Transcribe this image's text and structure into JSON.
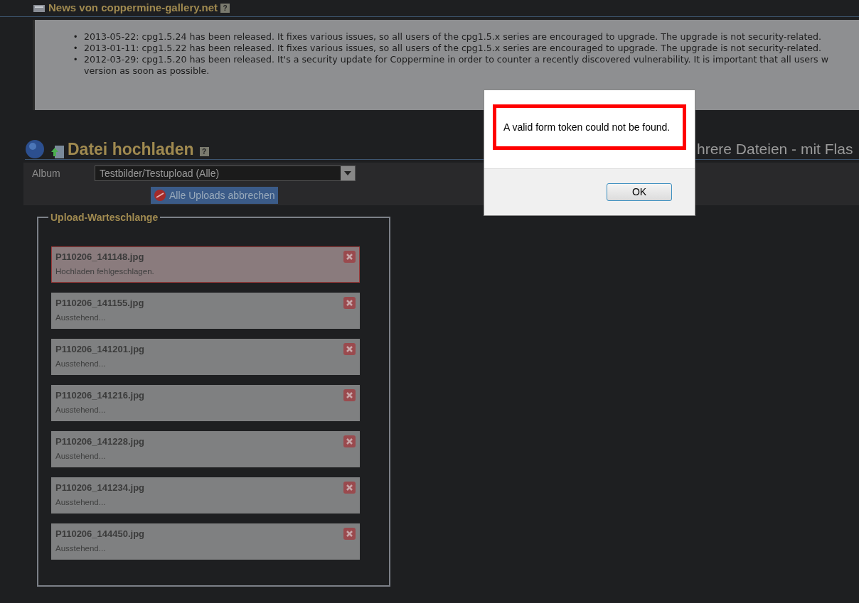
{
  "news": {
    "title": "News von coppermine-gallery.net",
    "help": "?",
    "items": [
      {
        "bullet": "•",
        "lines": [
          "2013-05-22: cpg1.5.24 has been released. It fixes various issues, so all users of the cpg1.5.x series are encouraged to upgrade. The upgrade is not security-related."
        ]
      },
      {
        "bullet": "•",
        "lines": [
          "2013-01-11: cpg1.5.22 has been released. It fixes various issues, so all users of the cpg1.5.x series are encouraged to upgrade. The upgrade is not security-related."
        ]
      },
      {
        "bullet": "•",
        "lines": [
          "2012-03-29: cpg1.5.20 has been released. It's a security update for Coppermine in order to counter a recently discovered vulnerability. It is important that all users w",
          "version as soon as possible."
        ]
      }
    ]
  },
  "upload": {
    "title": "Datei hochladen",
    "help": "?",
    "tab_text": "hrere Dateien - mit Flas",
    "album_label": "Album",
    "album_value": "Testbilder/Testupload (Alle)",
    "cancel_all": "Alle Uploads abbrechen",
    "queue": {
      "legend": "Upload-Warteschlange",
      "files": [
        {
          "name": "P110206_141148.jpg",
          "status": "Hochladen fehlgeschlagen.",
          "failed": true
        },
        {
          "name": "P110206_141155.jpg",
          "status": "Ausstehend...",
          "failed": false
        },
        {
          "name": "P110206_141201.jpg",
          "status": "Ausstehend...",
          "failed": false
        },
        {
          "name": "P110206_141216.jpg",
          "status": "Ausstehend...",
          "failed": false
        },
        {
          "name": "P110206_141228.jpg",
          "status": "Ausstehend...",
          "failed": false
        },
        {
          "name": "P110206_141234.jpg",
          "status": "Ausstehend...",
          "failed": false
        },
        {
          "name": "P110206_144450.jpg",
          "status": "Ausstehend...",
          "failed": false
        }
      ]
    }
  },
  "dialog": {
    "message": "A valid form token could not be found.",
    "button": "OK"
  }
}
